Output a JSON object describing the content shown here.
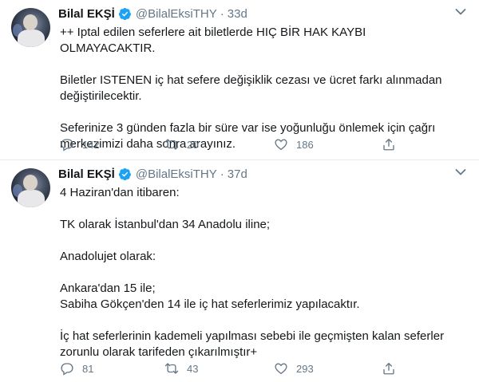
{
  "tweets": [
    {
      "author": {
        "name": "Bilal EKŞİ",
        "handle": "@BilalEksiTHY",
        "verified": true
      },
      "time": "33d",
      "lines": [
        "++ Iptal edilen seferlere ait biletlerde HIÇ BİR HAK KAYBI OLMAYACAKTIR.",
        "",
        "Biletler ISTENEN iç hat  sefere değişiklik cezası ve ücret farkı alınmadan",
        "değiştirilecektir.",
        "",
        "Seferinize 3 günden fazla bir süre var ise yoğunluğu önlemek için çağrı",
        "merkezimizi daha sonra arayınız."
      ],
      "replies": "142",
      "retweets": "20",
      "likes": "186"
    },
    {
      "author": {
        "name": "Bilal EKŞİ",
        "handle": "@BilalEksiTHY",
        "verified": true
      },
      "time": "37d",
      "lines": [
        "4 Haziran'dan itibaren:",
        "",
        "TK olarak İstanbul'dan 34 Anadolu iline;",
        "",
        "Anadolujet olarak:",
        "",
        "Ankara'dan 15 ile;",
        "Sabiha Gökçen'den 14 ile iç hat seferlerimiz yapılacaktır.",
        "",
        "İç hat seferlerinin kademeli yapılması sebebi ile geçmişten kalan seferler",
        "zorunlu olarak tarifeden çıkarılmıştır+"
      ],
      "replies": "81",
      "retweets": "43",
      "likes": "293"
    }
  ],
  "colors": {
    "verified": "#1da1f2",
    "secondary_text": "#657786",
    "divider": "#e6ecf0"
  },
  "icons": [
    "verified-badge-icon",
    "chevron-down-icon",
    "reply-icon",
    "retweet-icon",
    "like-icon",
    "share-icon"
  ]
}
